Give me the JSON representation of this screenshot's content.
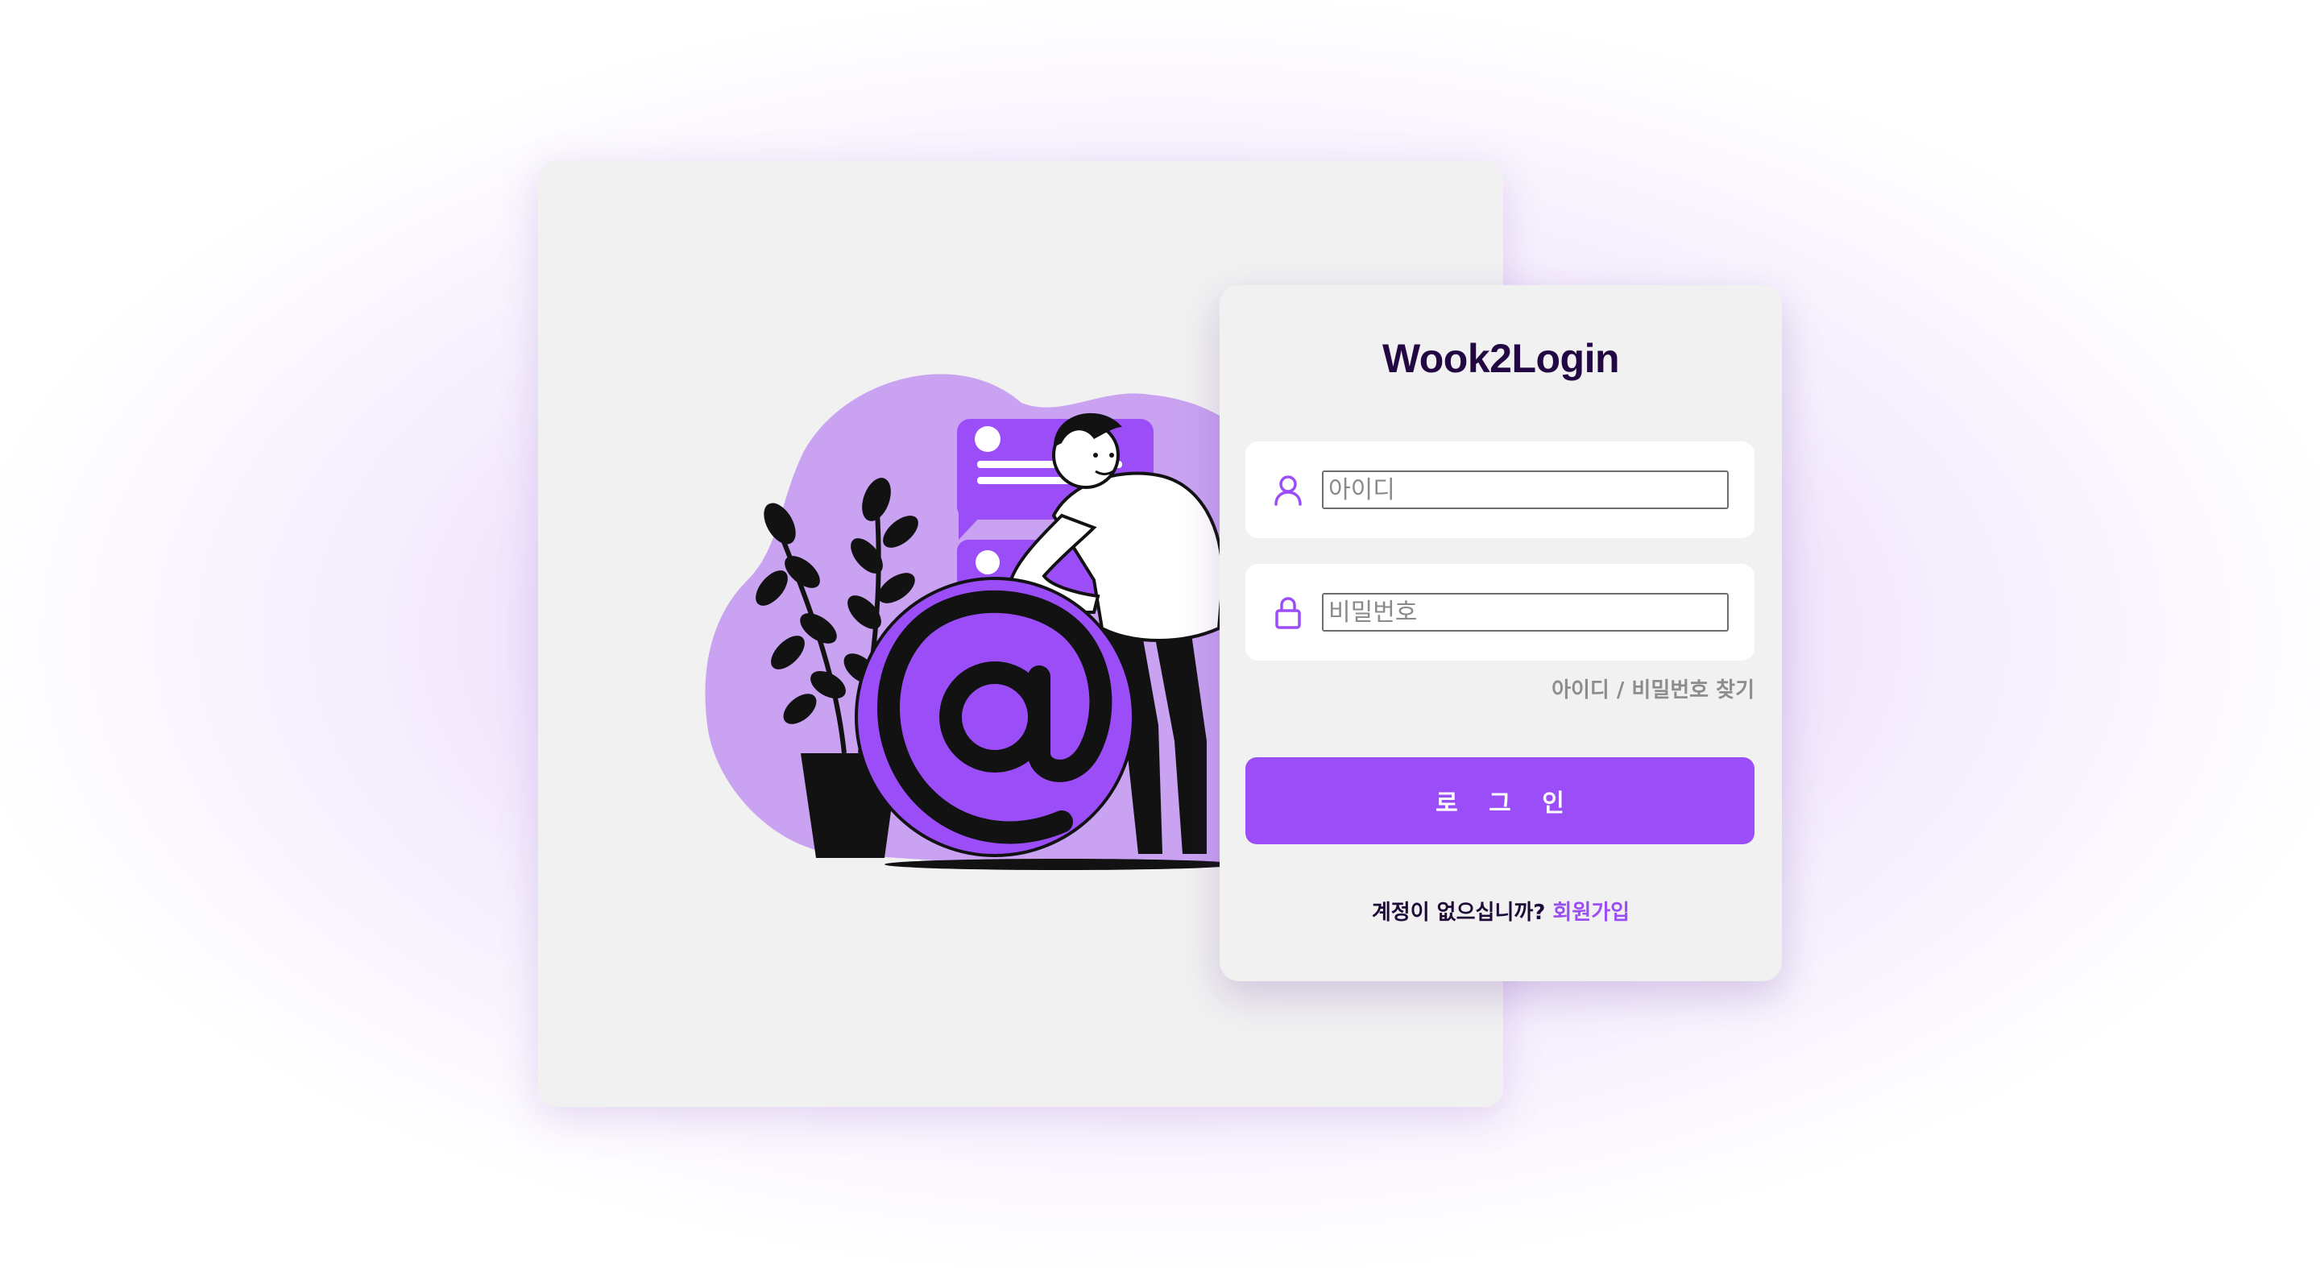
{
  "app": {
    "title": "Wook2Login"
  },
  "login": {
    "id_placeholder": "아이디",
    "pw_placeholder": "비밀번호",
    "find_label": "아이디 / 비밀번호 찾기",
    "button_label": "로 그 인",
    "no_account_text": "계정이 없으십니까? ",
    "signup_label": "회원가입"
  },
  "icons": {
    "id": "user-icon",
    "pw": "lock-icon",
    "illustration": "email-at-icon"
  },
  "colors": {
    "accent": "#9b4ef8",
    "accent_light": "#c9a3f2",
    "title": "#220742",
    "card_bg": "#f1f1f1",
    "field_bg": "#ffffff",
    "muted": "#8d8d8d"
  }
}
